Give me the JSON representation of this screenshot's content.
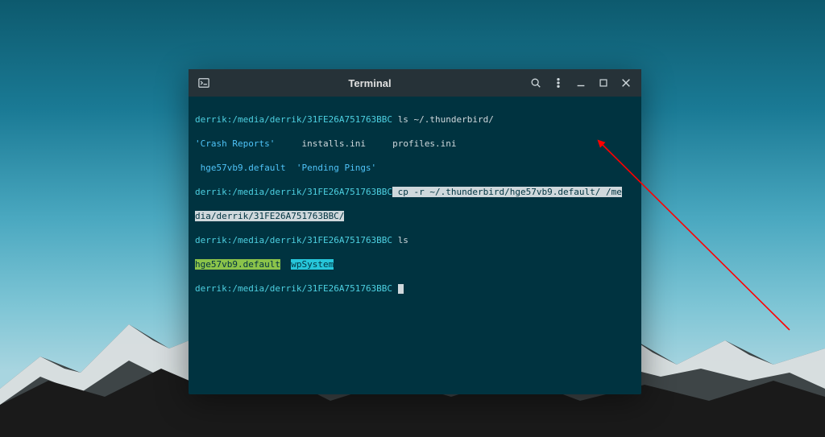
{
  "window": {
    "title": "Terminal",
    "app_icon": "terminal-icon"
  },
  "colors": {
    "titlebar_bg": "#263238",
    "term_bg": "#003340",
    "user_fg": "#4dd0e1",
    "sel_bg": "#cfd8dc",
    "hl_green": "#8bc34a",
    "hl_cyan": "#26c6da"
  },
  "prompt": {
    "user": "derrik",
    "path": "/media/derrik/31FE26A751763BBC"
  },
  "lines": {
    "l1_cmd": "ls ~/.thunderbird/",
    "l2a": "'Crash Reports'",
    "l2b": "installs.ini",
    "l2c": "profiles.ini",
    "l3a": " hge57vb9.default",
    "l3b": "'Pending Pings'",
    "l4_cmd_sel_a": " cp -r ~/.thunderbird/hge57vb9.default/ /me",
    "l5_sel": "dia/derrik/31FE26A751763BBC/",
    "l6_cmd": "ls",
    "l7a": "hge57vb9.default",
    "l7b": "wpSystem"
  }
}
